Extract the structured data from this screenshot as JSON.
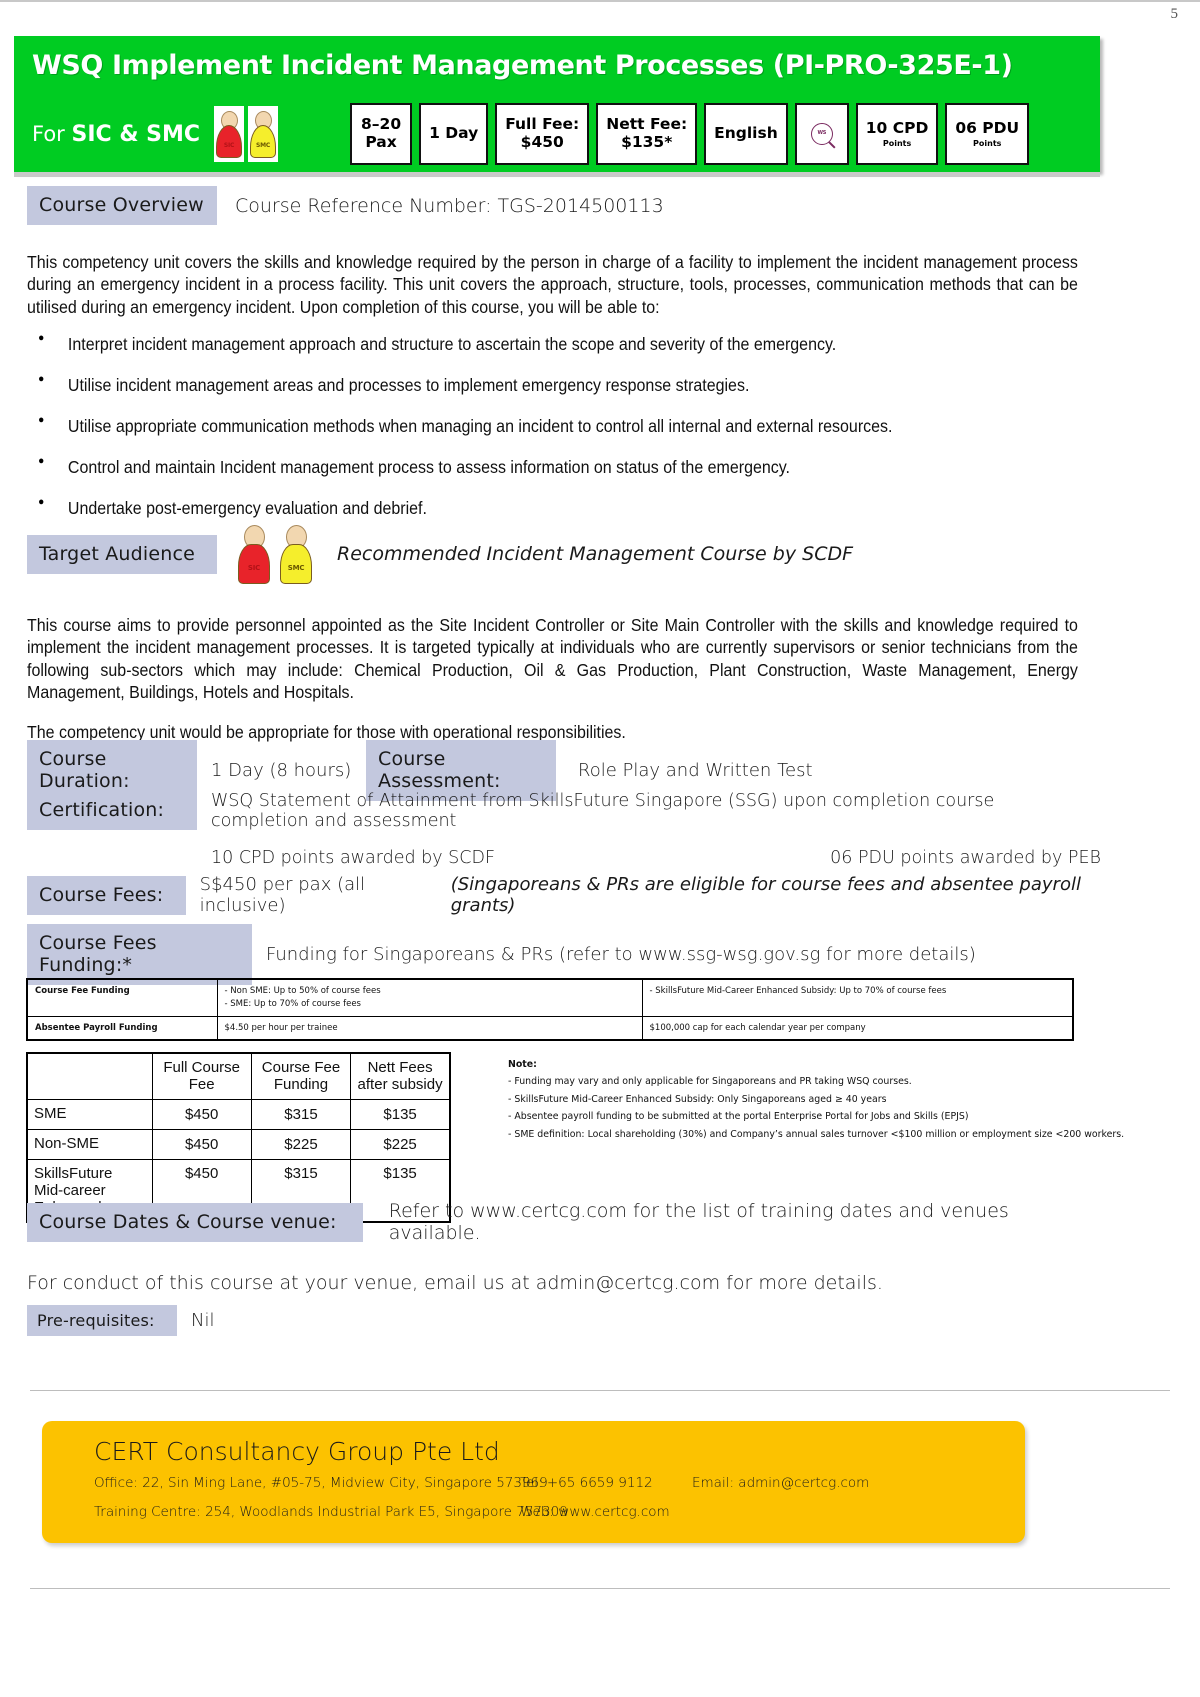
{
  "page": {
    "number": "5"
  },
  "banner": {
    "title": "WSQ Implement Incident Management Processes (PI-PRO-325E-1)",
    "for_prefix": "For ",
    "for_audience": "SIC & SMC",
    "person_sic": "SIC",
    "person_smc": "SMC",
    "chips": [
      {
        "line1": "8–20",
        "line2": "Pax",
        "sub": ""
      },
      {
        "line1": "1 Day",
        "line2": "",
        "sub": ""
      },
      {
        "line1": "Full Fee:",
        "line2": "$450",
        "sub": ""
      },
      {
        "line1": "Nett Fee:",
        "line2": "$135*",
        "sub": ""
      },
      {
        "line1": "English",
        "line2": "",
        "sub": ""
      },
      {
        "line1": "",
        "line2": "",
        "sub": "",
        "icon": "wsq-seal-icon"
      },
      {
        "line1": "10 CPD",
        "line2": "",
        "sub": "Points"
      },
      {
        "line1": "06 PDU",
        "line2": "",
        "sub": "Points"
      }
    ]
  },
  "overview": {
    "label": "Course Overview",
    "ref_label": "Course Reference Number:",
    "ref_number": "TGS-2014500113",
    "body": "This competency unit covers the skills and knowledge required by the person in charge of a facility to implement the incident management process during an emergency incident in a process facility. This unit covers the approach, structure, tools, processes, communication methods that can be utilised during an emergency incident. Upon completion of this course, you will be able to:",
    "bullets": [
      "Interpret incident management approach and structure to ascertain the scope and severity of the emergency.",
      "Utilise incident management areas and processes to implement emergency response strategies.",
      "Utilise appropriate communication methods when managing an incident to control all internal and external resources.",
      "Control and maintain Incident management process to assess information on status of the emergency.",
      "Undertake post-emergency evaluation and debrief."
    ]
  },
  "target_audience": {
    "label": "Target Audience",
    "recommended_note": "Recommended Incident Management Course by SCDF",
    "body": "This course aims to provide personnel appointed as the Site Incident Controller or Site Main Controller with the skills and knowledge required to implement the incident management processes. It is targeted typically at individuals who are currently supervisors or senior technicians from the following sub-sectors which may include: Chemical Production, Oil & Gas Production, Plant Construction, Waste Management, Energy Management, Buildings, Hotels and Hospitals.",
    "body2": "The competency unit would be appropriate for those with operational responsibilities."
  },
  "duration": {
    "label": "Course Duration:",
    "value": "1 Day (8 hours)"
  },
  "assessment": {
    "label": "Course Assessment:",
    "value": "Role Play and Written Test"
  },
  "certification": {
    "label": "Certification:",
    "value": "WSQ Statement of Attainment from SkillsFuture Singapore (SSG) upon completion course completion and assessment",
    "cpd": "10 CPD points awarded by SCDF",
    "pdu": "06 PDU points awarded by PEB"
  },
  "course_fees": {
    "label": "Course Fees:",
    "value": "S$450 per pax (all inclusive)",
    "note_italic": "(Singaporeans & PRs are eligible for course fees and absentee payroll grants)"
  },
  "fees_funding": {
    "label": "Course Fees Funding:*",
    "value": "Funding for Singaporeans & PRs (refer to www.ssg-wsg.gov.sg for more details)"
  },
  "funding_table": {
    "rows": [
      {
        "name": "Course Fee Funding",
        "col2": "- Non SME: Up to 50% of course fees\n- SME: Up to 70% of course fees",
        "col3": "- SkillsFuture Mid-Career Enhanced Subsidy: Up to 70% of course fees"
      },
      {
        "name": "Absentee Payroll Funding",
        "col2": "$4.50 per hour per trainee",
        "col3": "$100,000 cap for each calendar year per company"
      }
    ]
  },
  "fee_table": {
    "headers": [
      "",
      "Full Course Fee",
      "Course Fee Funding",
      "Nett Fees after subsidy"
    ],
    "rows": [
      {
        "label": "SME",
        "full": "$450",
        "funding": "$315",
        "nett": "$135"
      },
      {
        "label": "Non-SME",
        "full": "$450",
        "funding": "$225",
        "nett": "$225"
      },
      {
        "label": "SkillsFuture Mid-career Enhanced",
        "full": "$450",
        "funding": "$315",
        "nett": "$135"
      }
    ]
  },
  "note": {
    "title": "Note:",
    "items": [
      "- Funding may vary and only applicable for Singaporeans and PR taking WSQ courses.",
      "- SkillsFuture Mid-Career Enhanced Subsidy: Only Singaporeans aged ≥ 40 years",
      "- Absentee payroll funding to be submitted at the portal Enterprise Portal for Jobs and Skills (EPJS)",
      "- SME definition: Local shareholding (30%) and Company’s annual sales turnover <$100 million or employment size <200 workers."
    ]
  },
  "dates_venue": {
    "label": "Course Dates & Course venue:",
    "value": "Refer to www.certcg.com for the list of training dates and venues available.",
    "conduct_note": "For conduct of this course at your venue, email us at admin@certcg.com for more details."
  },
  "prerequisites": {
    "label": "Pre-requisites:",
    "value": "Nil"
  },
  "footer": {
    "company": "CERT Consultancy Group Pte Ltd",
    "office": "Office:  22, Sin Ming Lane, #05-75, Midview City, Singapore 573969",
    "training_centre": "Training Centre:  254, Woodlands Industrial Park E5, Singapore 757309",
    "tel": "Tel: +65 6659 9112",
    "email": "Email: admin@certcg.com",
    "web": "Web: www.certcg.com"
  },
  "colors": {
    "banner_green": "#00cc22",
    "label_lavender": "#c3c8de",
    "footer_gold": "#fcc200"
  }
}
